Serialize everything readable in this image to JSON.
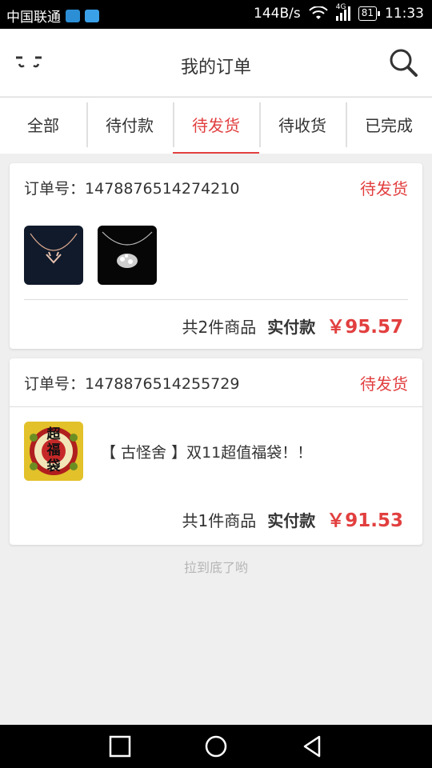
{
  "status_bar": {
    "carrier": "中国联通",
    "net_speed": "144B/s",
    "network_type": "4G",
    "battery": "81",
    "time": "11:33"
  },
  "header": {
    "title": "我的订单",
    "icons": {
      "left": "message-face-icon",
      "right": "search-icon"
    }
  },
  "tabs": [
    {
      "label": "全部",
      "active": false
    },
    {
      "label": "待付款",
      "active": false
    },
    {
      "label": "待发货",
      "active": true
    },
    {
      "label": "待收货",
      "active": false
    },
    {
      "label": "已完成",
      "active": false
    }
  ],
  "orders": [
    {
      "order_label": "订单号：",
      "order_no": "1478876514274210",
      "status": "待发货",
      "count_text": "共2件商品",
      "paid_label": "实付款",
      "price": "￥95.57"
    },
    {
      "order_label": "订单号：",
      "order_no": "1478876514255729",
      "status": "待发货",
      "item_name": "【 古怪舍 】双11超值福袋！！",
      "item_thumb_text": "超福袋",
      "count_text": "共1件商品",
      "paid_label": "实付款",
      "price": "￥91.53"
    }
  ],
  "footer_hint": "拉到底了哟",
  "colors": {
    "accent": "#e23f3f",
    "background": "#efefef"
  }
}
